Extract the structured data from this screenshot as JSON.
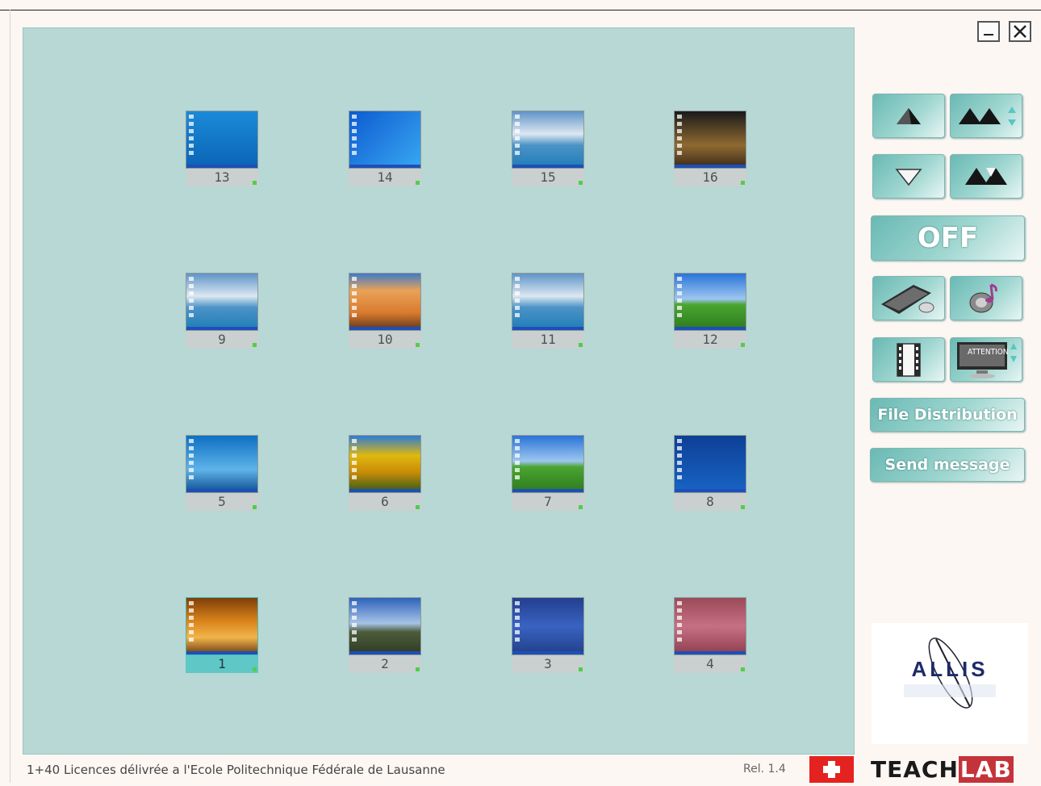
{
  "window": {
    "minimize_label": "_",
    "close_label": "X"
  },
  "students": [
    {
      "number": "13",
      "wallpaper": "orange fish on blue"
    },
    {
      "number": "14",
      "wallpaper": "blue abstract"
    },
    {
      "number": "15",
      "wallpaper": "clouds over sea"
    },
    {
      "number": "16",
      "wallpaper": "night city fountain"
    },
    {
      "number": "9",
      "wallpaper": "clouds over sea"
    },
    {
      "number": "10",
      "wallpaper": "desert dune"
    },
    {
      "number": "11",
      "wallpaper": "clouds over sea"
    },
    {
      "number": "12",
      "wallpaper": "green hill bliss"
    },
    {
      "number": "5",
      "wallpaper": "dolphins"
    },
    {
      "number": "6",
      "wallpaper": "yellow tulips"
    },
    {
      "number": "7",
      "wallpaper": "green hill bliss"
    },
    {
      "number": "8",
      "wallpaper": "blue desktop with window"
    },
    {
      "number": "1",
      "wallpaper": "autumn forest path",
      "selected": true
    },
    {
      "number": "2",
      "wallpaper": "stonehenge"
    },
    {
      "number": "3",
      "wallpaper": "moon over mountain"
    },
    {
      "number": "4",
      "wallpaper": "pink adobe wall"
    }
  ],
  "controls": {
    "up_icon": "triangle-up-icon",
    "up_all_icon": "double-triangle-up-icon",
    "down_icon": "triangle-down-icon",
    "down_all_icon": "double-triangle-down-icon",
    "off_label": "OFF",
    "keyboard_icon": "keyboard-mouse-icon",
    "audio_icon": "speaker-music-icon",
    "video_icon": "film-icon",
    "attention_label": "ATTENTION",
    "file_distribution_label": "File Distribution",
    "send_message_label": "Send message"
  },
  "footer": {
    "license_text": "1+40 Licences délivrée a l'Ecole Politechnique Fédérale de Lausanne",
    "release": "Rel. 1.4",
    "brand_left": "TEACH",
    "brand_right": "LAB"
  },
  "logo": {
    "text": "ALLIS"
  },
  "colors": {
    "panel": "#b7d8d4",
    "button": "#8ccbc5",
    "flag": "#e42320",
    "brand_red": "#c5333a"
  }
}
